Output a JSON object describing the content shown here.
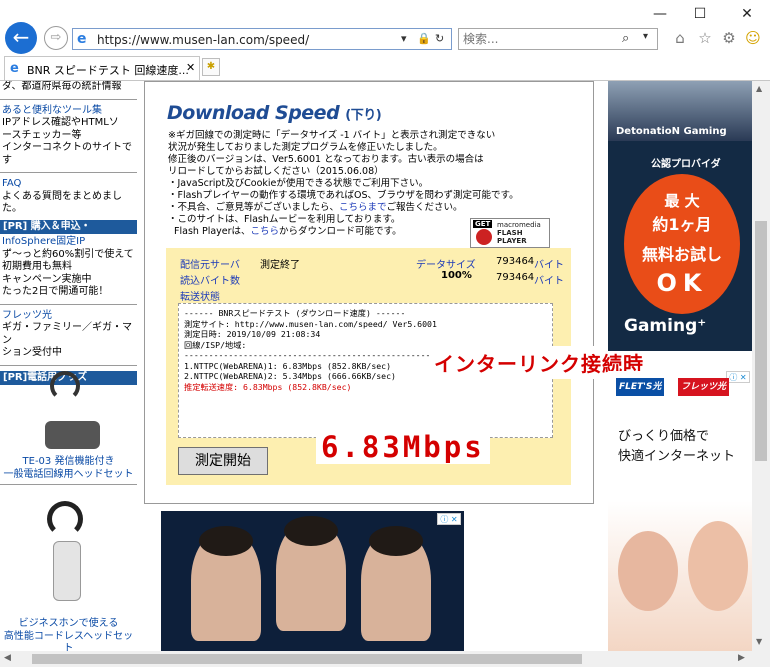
{
  "window": {
    "minimize_glyph": "—",
    "maximize_glyph": "☐",
    "close_glyph": "✕"
  },
  "nav": {
    "back_glyph": "←",
    "forward_glyph": "⇨",
    "url": "https://www.musen-lan.com/speed/",
    "search_placeholder": "検索...",
    "icons": [
      "home-icon",
      "star-icon",
      "gear-icon",
      "smiley-icon"
    ]
  },
  "tab": {
    "title": "BNR スピードテスト 回線速度...",
    "close": "✕"
  },
  "left": {
    "top_line": "ダ、都道府県毎の統計情報",
    "tools_title": "あると便利なツール集",
    "tools_lines": [
      "IPアドレス確認やHTMLソ",
      "ースチェッカー等",
      "インターコネクトのサイトです"
    ],
    "faq_title": "FAQ",
    "faq_line": "よくある質問をまとめました。",
    "pr1": "[PR] 購入＆申込・",
    "infosphere": "InfoSphere固定IP",
    "infosphere_lines": [
      "ず～っと約60%割引で使えて",
      "初期費用も無料",
      "キャンペーン実施中",
      "たった2日で開通可能！"
    ],
    "flets_link": "フレッツ光",
    "flets_lines": [
      "ギガ・ファミリー／ギガ・マン",
      "ション受付中"
    ],
    "pr2": "[PR]電話用グッズ",
    "product1_lines": [
      "TE-03 発信機能付き",
      "一般電話回線用ヘッドセット"
    ],
    "product2_lines": [
      "ビジネスホンで使える",
      "高性能コードレスヘッドセット"
    ]
  },
  "main": {
    "heading": "Download Speed",
    "heading_sub": "(下り)",
    "notice_lines": [
      "※ギガ回線での測定時に「データサイズ -1 バイト」と表示され測定できない",
      "状況が発生しておりました測定プログラムを修正いたしました。",
      "修正後のバージョンは、Ver5.6001 となっております。古い表示の場合は",
      "リロードしてからお試しください（2015.06.08）",
      "・JavaScript及びCookieが使用できる状態でご利用下さい。",
      "・Flashプレイヤーの動作する環境であればOS、ブラウザを問わず測定可能です。"
    ],
    "notice_7a": "・不具合、ご意見等がございましたら、",
    "notice_7link": "こちらまで",
    "notice_7b": "ご報告ください。",
    "notice_8": "・このサイトは、Flashムービーを利用しております。",
    "notice_9a": "Flash Playerは、",
    "notice_9link": "こちら",
    "notice_9b": "からダウンロード可能です。",
    "flash_badge": {
      "get": "GET",
      "line1": "macromedia",
      "line2": "FLASH",
      "line3": "PLAYER"
    }
  },
  "panel": {
    "server_label": "配信元サーバ",
    "server_value": "測定終了",
    "datasize_label": "データサイズ",
    "datasize_value": "793464",
    "datasize_unit": "バイト",
    "read_label": "読込バイト数",
    "percent": "100%",
    "read_value": "793464",
    "read_unit": "バイト",
    "transfer_label": "転送状態",
    "result_lines": [
      "------ BNRスピードテスト (ダウンロード速度) ------",
      "測定サイト: http://www.musen-lan.com/speed/ Ver5.6001",
      "測定日時: 2019/10/09 21:08:34",
      "回線/ISP/地域:",
      "--------------------------------------------------",
      "",
      "1.NTTPC(WebARENA)1: 6.83Mbps (852.8KB/sec)",
      "2.NTTPC(WebARENA)2: 5.34Mbps (666.66KB/sec)"
    ],
    "result_red": "推定転送速度: 6.83Mbps (852.8KB/sec)",
    "measure_button": "測定開始"
  },
  "overlays": {
    "connection_label": "インターリンク接続時",
    "speed_label": "6.83Mbps"
  },
  "right_ad": {
    "brand": "DetonatioN Gaming",
    "sub": "公認プロバイダ",
    "circle_lines": [
      "最 大",
      "約1ヶ月",
      "無料お試し",
      "OK"
    ],
    "gaming": "Gaming⁺"
  },
  "right_ad2": {
    "badge1": "FLET'S光",
    "badge2": "フレッツ光",
    "line1": "びっくり価格で",
    "line2": "快適インターネット"
  },
  "adchoice": "ⓘ ✕",
  "colors": {
    "accent_blue": "#1e5a9c",
    "link_blue": "#1b39b8",
    "panel_yellow": "#fdefb0",
    "highlight_red": "#d40000",
    "ad_orange": "#e94d18"
  }
}
